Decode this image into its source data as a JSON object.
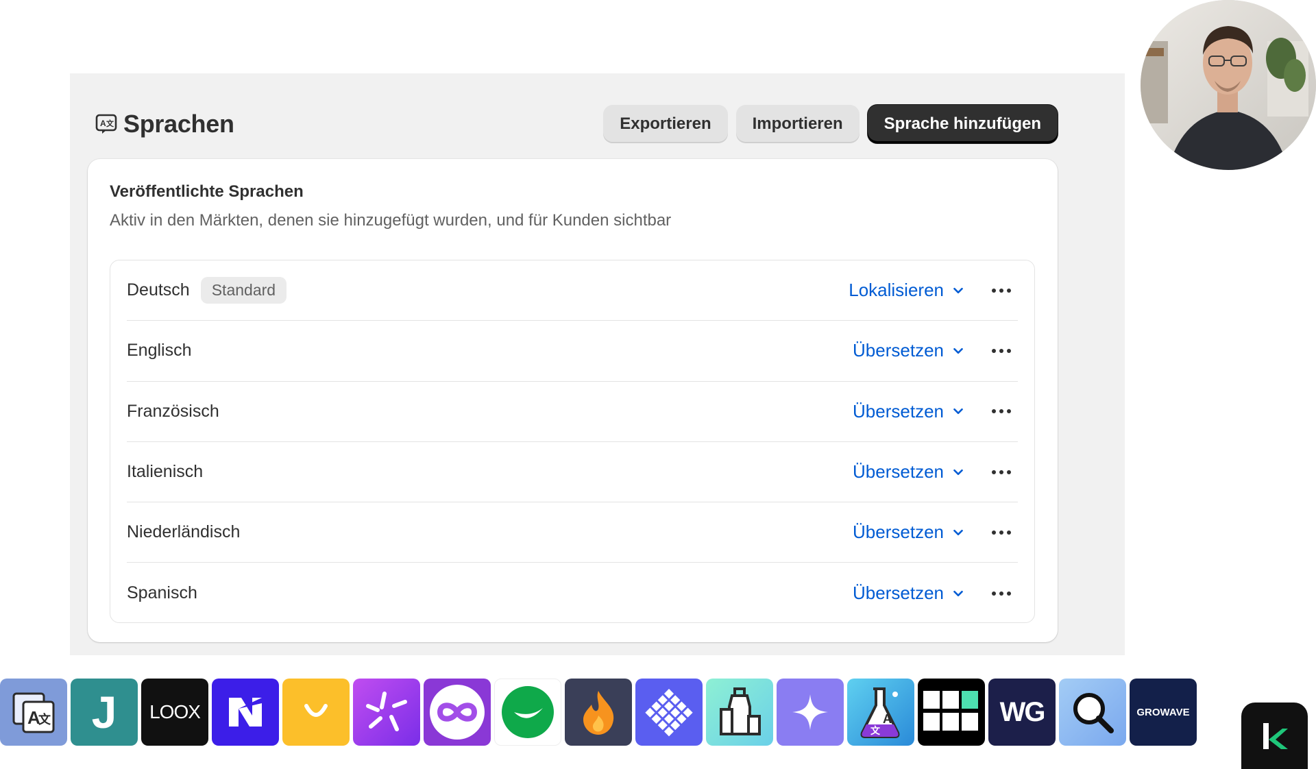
{
  "header": {
    "title": "Sprachen",
    "buttons": {
      "export": "Exportieren",
      "import": "Importieren",
      "add": "Sprache hinzufügen"
    }
  },
  "card": {
    "title": "Veröffentlichte Sprachen",
    "subtitle": "Aktiv in den Märkten, denen sie hinzugefügt wurden, und für Kunden sichtbar"
  },
  "languages": [
    {
      "name": "Deutsch",
      "badge": "Standard",
      "action": "Lokalisieren"
    },
    {
      "name": "Englisch",
      "action": "Übersetzen"
    },
    {
      "name": "Französisch",
      "action": "Übersetzen"
    },
    {
      "name": "Italienisch",
      "action": "Übersetzen"
    },
    {
      "name": "Niederländisch",
      "action": "Übersetzen"
    },
    {
      "name": "Spanisch",
      "action": "Übersetzen"
    }
  ],
  "dock": {
    "apps": [
      {
        "icon": "translate-app-icon",
        "bg": "#7f9bd9"
      },
      {
        "icon": "judgeme-icon",
        "label": "J",
        "bg": "#2f8f8f"
      },
      {
        "icon": "loox-icon",
        "label": "LOOX",
        "bg": "#111111"
      },
      {
        "icon": "app-n-icon",
        "bg": "#3c1ee8"
      },
      {
        "icon": "smile-icon",
        "bg": "#fcbf2a"
      },
      {
        "icon": "sparkle-burst-icon",
        "bg": "#a23cf0"
      },
      {
        "icon": "infinity-icon",
        "bg": "#8a38d6"
      },
      {
        "icon": "green-circle-icon",
        "bg": "#ffffff"
      },
      {
        "icon": "flame-icon",
        "bg": "#3a3f58"
      },
      {
        "icon": "diamond-grid-icon",
        "bg": "#5a5ef0"
      },
      {
        "icon": "bottles-icon",
        "bg": "#7ae3c8"
      },
      {
        "icon": "star-sparkle-icon",
        "bg": "#8a7df2"
      },
      {
        "icon": "flask-translate-icon",
        "bg": "#3aa8e0"
      },
      {
        "icon": "grid-blocks-icon",
        "bg": "#000000"
      },
      {
        "icon": "wg-icon",
        "label": "WG",
        "bg": "#1c1f4a"
      },
      {
        "icon": "search-magnifier-icon",
        "bg": "#8fb8f0"
      },
      {
        "icon": "growave-icon",
        "label": "GROWAVE",
        "bg": "#13204a"
      }
    ]
  },
  "colors": {
    "link": "#005bd3",
    "primary_button": "#303030",
    "panel_bg": "#f1f1f1"
  }
}
